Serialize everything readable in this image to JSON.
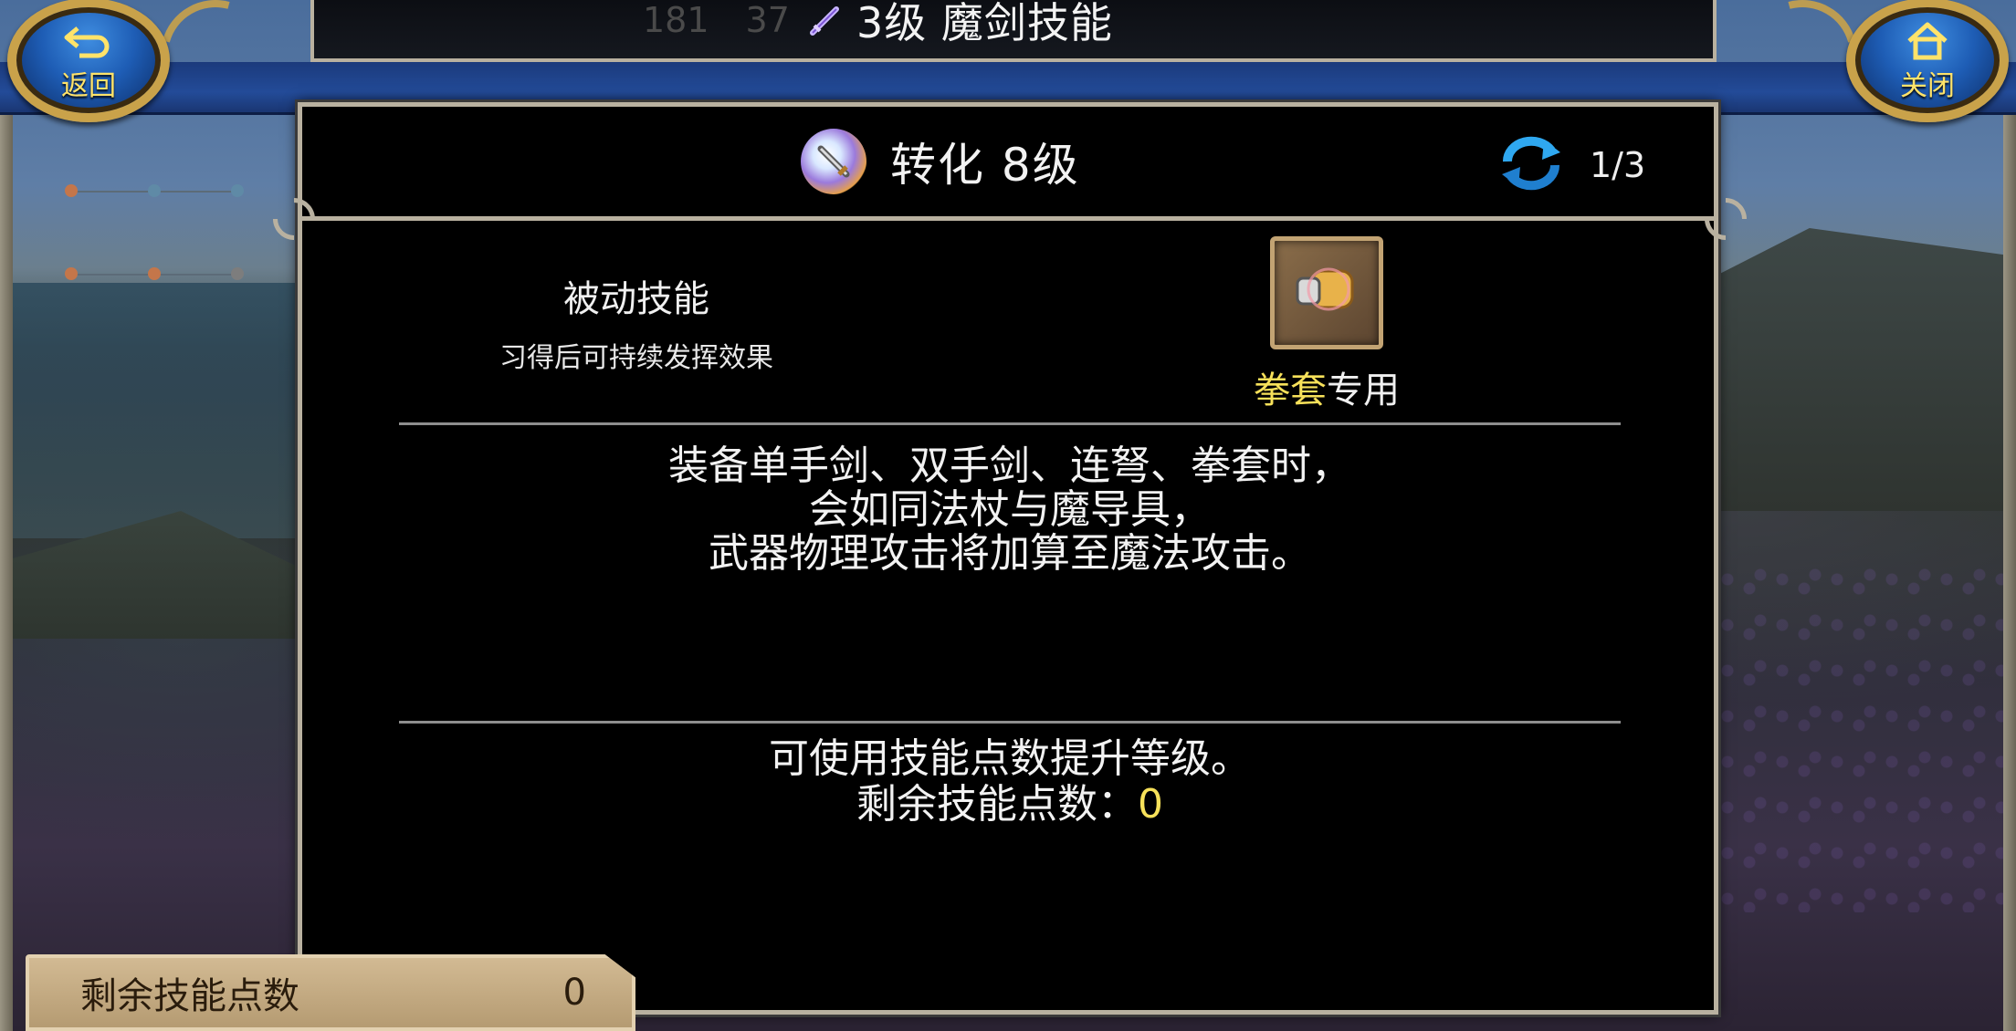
{
  "header": {
    "title": "3级 魔剑技能",
    "hud_ghost": [
      "181",
      "37"
    ]
  },
  "nav": {
    "back_label": "返回",
    "close_label": "关闭"
  },
  "skill": {
    "title": "转化 8级",
    "page_count": "1/3",
    "type_title": "被动技能",
    "type_desc": "习得后可持续发挥效果",
    "weapon_highlight": "拳套",
    "weapon_suffix": "专用",
    "description": [
      "装备单手剑、双手剑、连弩、拳套时，",
      "会如同法杖与魔导具，",
      "武器物理攻击将加算至魔法攻击。"
    ],
    "upgrade_hint": "可使用技能点数提升等级。",
    "remaining_label": "剩余技能点数：",
    "remaining_value": "0"
  },
  "points_bar": {
    "label": "剩余技能点数",
    "value": "0"
  },
  "colors": {
    "highlight": "#f7e15a",
    "frame": "#b9b1a0",
    "nav_gold": "#c9a24a",
    "nav_blue": "#1e5db5"
  },
  "icons": [
    "sword-skill-icon",
    "back-arrow-icon",
    "home-icon",
    "refresh-cycle-icon",
    "gauntlet-icon"
  ]
}
